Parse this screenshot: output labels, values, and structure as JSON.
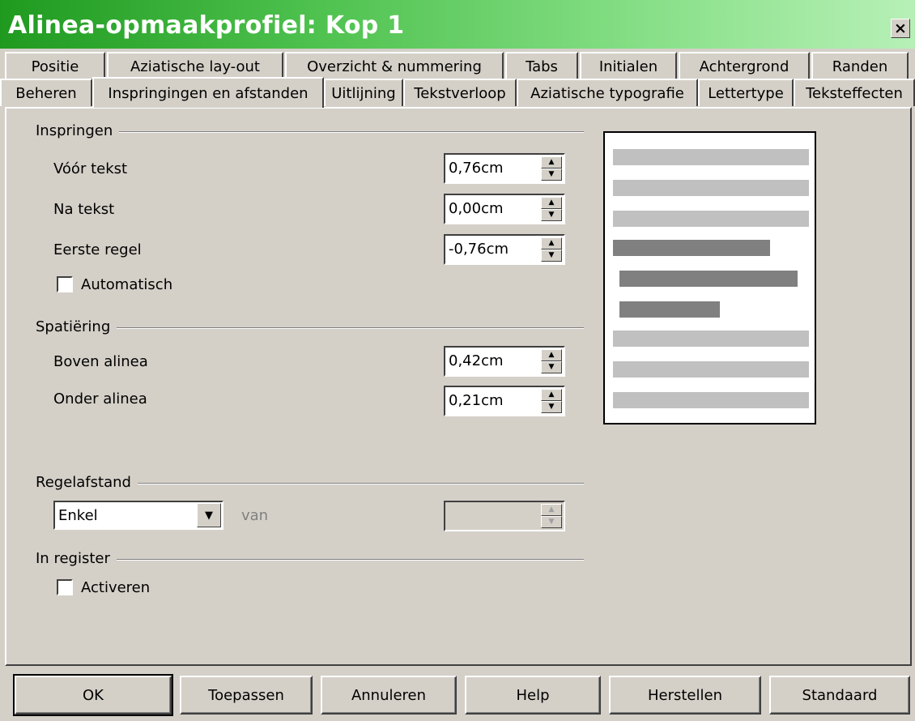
{
  "window": {
    "title": "Alinea-opmaakprofiel: Kop 1",
    "close_glyph": "×"
  },
  "tabs": {
    "back_row": [
      "Positie",
      "Aziatische lay-out",
      "Overzicht & nummering",
      "Tabs",
      "Initialen",
      "Achtergrond",
      "Randen"
    ],
    "front_row": [
      "Beheren",
      "Inspringingen en afstanden",
      "Uitlijning",
      "Tekstverloop",
      "Aziatische typografie",
      "Lettertype",
      "Teksteffecten"
    ],
    "active": "Inspringingen en afstanden"
  },
  "inspringen": {
    "heading": "Inspringen",
    "voor_tekst": {
      "label": "Vóór tekst",
      "value": "0,76cm"
    },
    "na_tekst": {
      "label": "Na tekst",
      "value": "0,00cm"
    },
    "eerste_regel": {
      "label": "Eerste regel",
      "value": "-0,76cm"
    },
    "automatisch": {
      "label": "Automatisch",
      "checked": false
    }
  },
  "spatiering": {
    "heading": "Spatiëring",
    "boven_alinea": {
      "label": "Boven alinea",
      "value": "0,42cm"
    },
    "onder_alinea": {
      "label": "Onder alinea",
      "value": "0,21cm"
    }
  },
  "regelafstand": {
    "heading": "Regelafstand",
    "mode": "Enkel",
    "van_label": "van",
    "value": ""
  },
  "in_register": {
    "heading": "In register",
    "activeren": {
      "label": "Activeren",
      "checked": false
    }
  },
  "buttons": {
    "ok": "OK",
    "apply": "Toepassen",
    "cancel": "Annuleren",
    "help": "Help",
    "reset": "Herstellen",
    "standard": "Standaard"
  },
  "colors": {
    "title_gradient_start": "#1f9a1f",
    "title_gradient_end": "#b7f0b7",
    "dialog_bg": "#d4d0c8",
    "preview_light_line": "#c0c0c0",
    "preview_dark_line": "#808080"
  }
}
